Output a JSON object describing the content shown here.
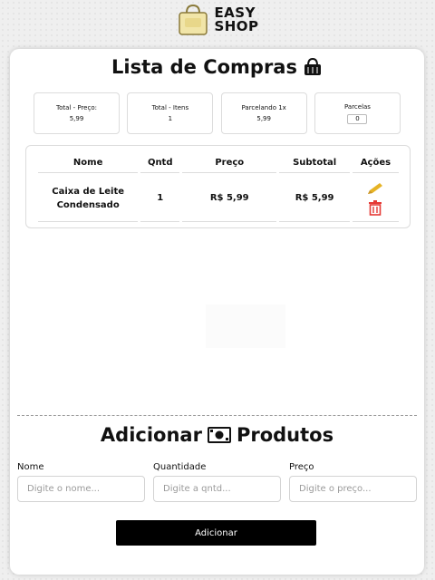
{
  "header": {
    "logo_line1": "EASY",
    "logo_line2": "SHOP"
  },
  "list": {
    "title": "Lista de Compras"
  },
  "summary": {
    "total_price_label": "Total - Preço:",
    "total_price_value": "5,99",
    "total_items_label": "Total - Itens",
    "total_items_value": "1",
    "installment_label": "Parcelando 1x",
    "installment_value": "5,99",
    "parcelas_label": "Parcelas",
    "parcelas_value": "0"
  },
  "table": {
    "headers": [
      "Nome",
      "Qntd",
      "Preço",
      "Subtotal",
      "Ações"
    ],
    "rows": [
      {
        "name_line1": "Caixa de Leite",
        "name_line2": "Condensado",
        "qty": "1",
        "price": "R$ 5,99",
        "subtotal": "R$ 5,99"
      }
    ]
  },
  "add": {
    "title_left": "Adicionar",
    "title_right": "Produtos",
    "name_label": "Nome",
    "name_placeholder": "Digite o nome...",
    "qty_label": "Quantidade",
    "qty_placeholder": "Digite a qntd...",
    "price_label": "Preço",
    "price_placeholder": "Digite o preço...",
    "button_label": "Adicionar"
  },
  "colors": {
    "accent": "#000000",
    "edit_icon": "#e6b325",
    "delete_icon": "#e53935"
  },
  "icons": {
    "logo": "shopping-bag-icon",
    "title": "basket-icon",
    "add": "cash-icon",
    "edit": "pencil-icon",
    "delete": "trash-icon"
  }
}
